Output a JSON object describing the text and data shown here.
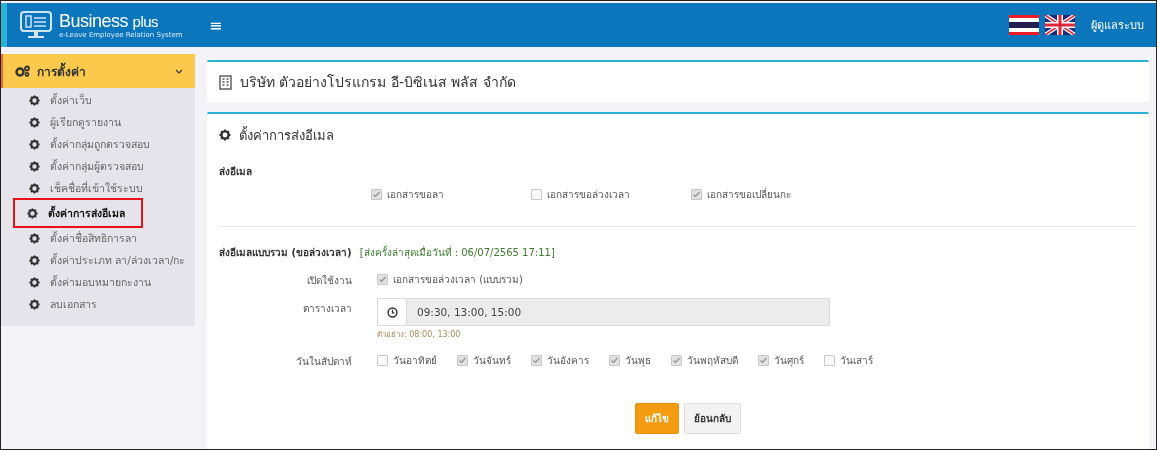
{
  "header": {
    "brand": "Business",
    "brand_suffix": "plus",
    "tagline": "e-Leave Employee Relation System",
    "menu_glyph": "≡",
    "user": "ผู้ดูแลระบบ"
  },
  "sidebar": {
    "section": "การตั้งค่า",
    "expanded": true,
    "items": [
      {
        "label": "ตั้งค่าเว็บ",
        "selected": false
      },
      {
        "label": "ผู้เรียกดูรายงาน",
        "selected": false
      },
      {
        "label": "ตั้งค่ากลุ่มถูกตรวจสอบ",
        "selected": false
      },
      {
        "label": "ตั้งค่ากลุ่มผู้ตรวจสอบ",
        "selected": false
      },
      {
        "label": "เช็คชื่อที่เข้าใช้ระบบ",
        "selected": false
      },
      {
        "label": "ตั้งค่าการส่งอีเมล",
        "selected": true
      },
      {
        "label": "ตั้งค่าชื่อสิทธิการลา",
        "selected": false
      },
      {
        "label": "ตั้งค่าประเภท ลา/ล่วงเวลา/กะ",
        "selected": false
      },
      {
        "label": "ตั้งค่ามอบหมายกะงาน",
        "selected": false
      },
      {
        "label": "ลบเอกสาร",
        "selected": false
      }
    ]
  },
  "company": {
    "title": "บริษัท ตัวอย่างโปรแกรม อี-บิซิเนส พลัส จำกัด"
  },
  "panel": {
    "title": "ตั้งค่าการส่งอีเมล",
    "send_email": {
      "label": "ส่งอีเมล",
      "options": [
        {
          "label": "เอกสารขอลา",
          "checked": true
        },
        {
          "label": "เอกสารขอล่วงเวลา",
          "checked": false
        },
        {
          "label": "เอกสารขอเปลี่ยนกะ",
          "checked": true
        }
      ]
    },
    "batch": {
      "label": "ส่งอีเมลแบบรวม (ขอล่วงเวลา)",
      "last_sent": "[ส่งครั้งล่าสุดเมื่อวันที่ : 06/07/2565 17:11]",
      "enable_label": "เปิดใช้งาน",
      "enable": {
        "label": "เอกสารขอล่วงเวลา (แบบรวม)",
        "checked": true
      },
      "schedule_label": "ตารางเวลา",
      "schedule_value": "09:30, 13:00, 15:00",
      "schedule_hint": "ตัวอย่าง: 08:00, 13:00",
      "days_label": "วันในสัปดาห์",
      "days": [
        {
          "label": "วันอาทิตย์",
          "checked": false
        },
        {
          "label": "วันจันทร์",
          "checked": true
        },
        {
          "label": "วันอังคาร",
          "checked": true
        },
        {
          "label": "วันพุธ",
          "checked": true
        },
        {
          "label": "วันพฤหัสบดี",
          "checked": true
        },
        {
          "label": "วันศุกร์",
          "checked": true
        },
        {
          "label": "วันเสาร์",
          "checked": false
        }
      ]
    },
    "buttons": [
      {
        "label": "แก้ไข",
        "kind": "primary"
      },
      {
        "label": "ย้อนกลับ",
        "kind": "default"
      }
    ]
  }
}
